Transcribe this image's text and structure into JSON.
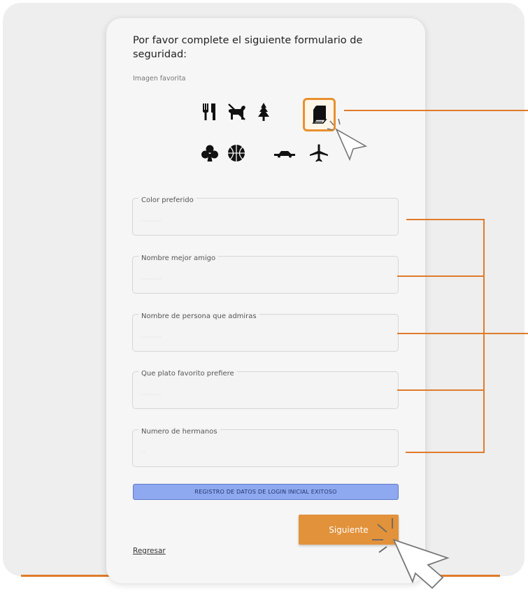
{
  "form": {
    "title": "Por favor complete el siguiente formulario de seguridad:",
    "image_label": "Imagen favorita",
    "images": [
      {
        "icon": "utensils-icon",
        "selected": false
      },
      {
        "icon": "dog-icon",
        "selected": false
      },
      {
        "icon": "tree-icon",
        "selected": false
      },
      {
        "icon": "book-icon",
        "selected": true
      },
      {
        "icon": "club-icon",
        "selected": false
      },
      {
        "icon": "basketball-icon",
        "selected": false
      },
      {
        "icon": "car-icon",
        "selected": false
      },
      {
        "icon": "airplane-icon",
        "selected": false
      }
    ],
    "fields": [
      {
        "label": "Color preferido",
        "value": ""
      },
      {
        "label": "Nombre mejor amigo",
        "value": ""
      },
      {
        "label": "Nombre de persona que admiras",
        "value": ""
      },
      {
        "label": "Que plato favorito prefiere",
        "value": ""
      },
      {
        "label": "Numero de hermanos",
        "value": ""
      }
    ],
    "status_message": "REGISTRO DE DATOS DE LOGIN INICIAL EXITOSO",
    "next_button": "Siguiente",
    "back_link": "Regresar"
  },
  "colors": {
    "accent": "#e2923a",
    "annotation": "#e07b2a",
    "status_bg": "#8ea9f0",
    "background": "#eeeeee",
    "card": "#f6f6f6"
  }
}
